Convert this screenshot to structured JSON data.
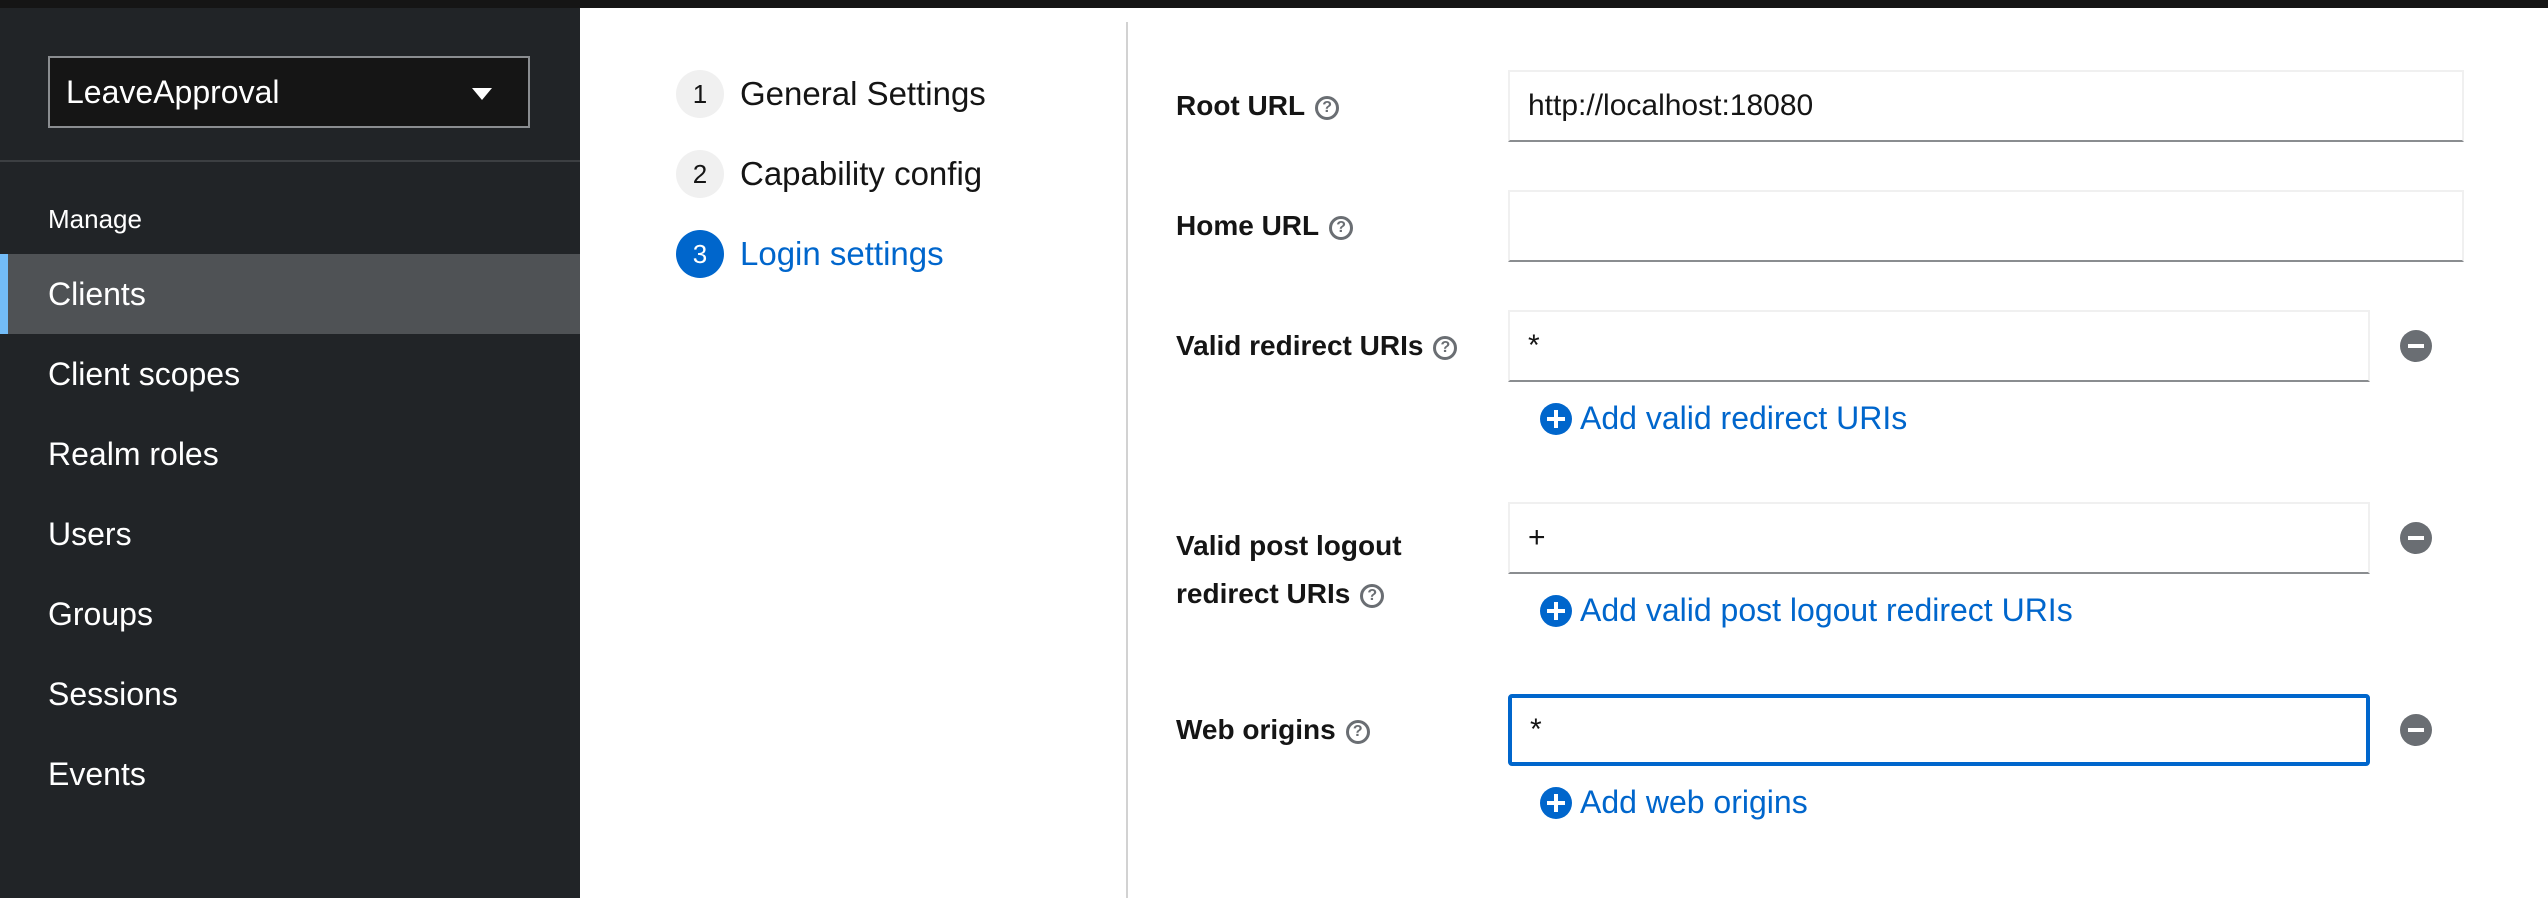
{
  "sidebar": {
    "realm": "LeaveApproval",
    "section": "Manage",
    "items": [
      {
        "label": "Clients",
        "active": true
      },
      {
        "label": "Client scopes"
      },
      {
        "label": "Realm roles"
      },
      {
        "label": "Users"
      },
      {
        "label": "Groups"
      },
      {
        "label": "Sessions"
      },
      {
        "label": "Events"
      }
    ]
  },
  "wizard": {
    "steps": [
      {
        "num": "1",
        "label": "General Settings"
      },
      {
        "num": "2",
        "label": "Capability config"
      },
      {
        "num": "3",
        "label": "Login settings",
        "current": true
      }
    ]
  },
  "form": {
    "root_url": {
      "label": "Root URL",
      "value": "http://localhost:18080"
    },
    "home_url": {
      "label": "Home URL",
      "value": ""
    },
    "valid_redirect": {
      "label": "Valid redirect URIs",
      "value": "*",
      "add": "Add valid redirect URIs"
    },
    "post_logout": {
      "label_line1": "Valid post logout",
      "label_line2": "redirect URIs",
      "value": "+",
      "add": "Add valid post logout redirect URIs"
    },
    "web_origins": {
      "label": "Web origins",
      "value": "*",
      "add": "Add web origins"
    }
  },
  "icons": {
    "help": "help-icon",
    "remove": "minus-circle-icon",
    "add": "plus-circle-icon",
    "caret": "caret-down-icon"
  },
  "colors": {
    "accent": "#0066cc",
    "sidebar_bg": "#212427",
    "active_nav": "#4f5255",
    "active_indicator": "#73bcf7"
  }
}
